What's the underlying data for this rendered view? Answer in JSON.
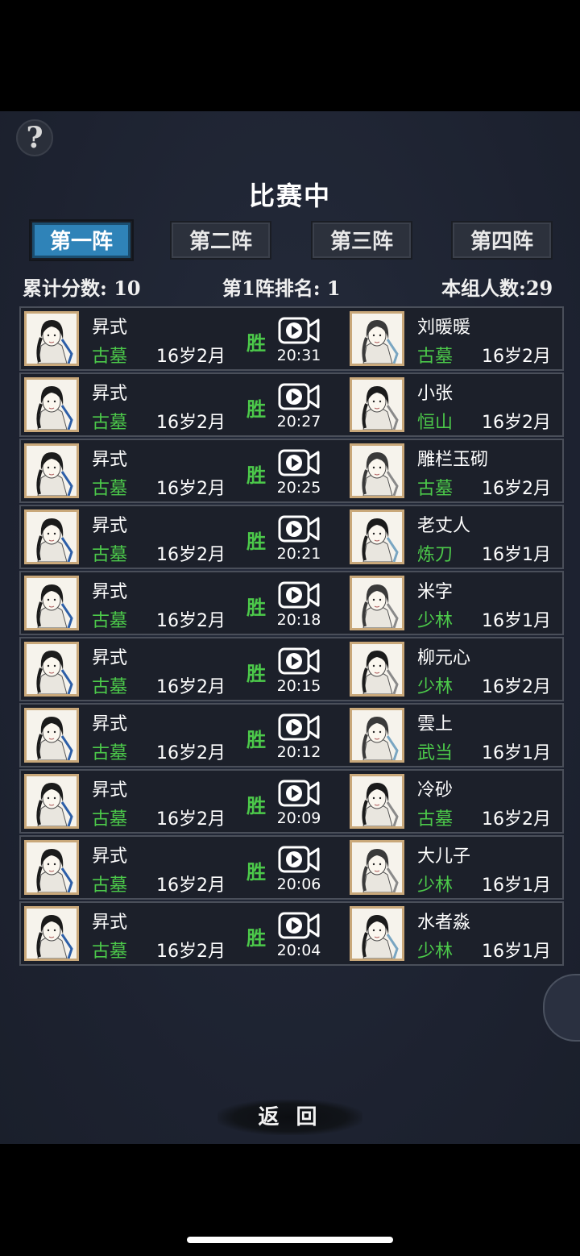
{
  "help": {
    "glyph": "?"
  },
  "title": "比赛中",
  "tabs": [
    {
      "label": "第一阵",
      "active": true
    },
    {
      "label": "第二阵",
      "active": false
    },
    {
      "label": "第三阵",
      "active": false
    },
    {
      "label": "第四阵",
      "active": false
    }
  ],
  "stats": {
    "score_label": "累计分数: 10",
    "rank_label": "第1阵排名: 1",
    "group_label": "本组人数:29"
  },
  "matches": [
    {
      "left": {
        "name": "昇式",
        "sect": "古墓",
        "age": "16岁2月"
      },
      "result": "胜",
      "time": "20:31",
      "right": {
        "name": "刘暖暖",
        "sect": "古墓",
        "age": "16岁2月"
      }
    },
    {
      "left": {
        "name": "昇式",
        "sect": "古墓",
        "age": "16岁2月"
      },
      "result": "胜",
      "time": "20:27",
      "right": {
        "name": "小张",
        "sect": "恒山",
        "age": "16岁2月"
      }
    },
    {
      "left": {
        "name": "昇式",
        "sect": "古墓",
        "age": "16岁2月"
      },
      "result": "胜",
      "time": "20:25",
      "right": {
        "name": "雕栏玉砌",
        "sect": "古墓",
        "age": "16岁2月"
      }
    },
    {
      "left": {
        "name": "昇式",
        "sect": "古墓",
        "age": "16岁2月"
      },
      "result": "胜",
      "time": "20:21",
      "right": {
        "name": "老丈人",
        "sect": "炼刀",
        "age": "16岁1月"
      }
    },
    {
      "left": {
        "name": "昇式",
        "sect": "古墓",
        "age": "16岁2月"
      },
      "result": "胜",
      "time": "20:18",
      "right": {
        "name": "米字",
        "sect": "少林",
        "age": "16岁1月"
      }
    },
    {
      "left": {
        "name": "昇式",
        "sect": "古墓",
        "age": "16岁2月"
      },
      "result": "胜",
      "time": "20:15",
      "right": {
        "name": "柳元心",
        "sect": "少林",
        "age": "16岁2月"
      }
    },
    {
      "left": {
        "name": "昇式",
        "sect": "古墓",
        "age": "16岁2月"
      },
      "result": "胜",
      "time": "20:12",
      "right": {
        "name": "雲上",
        "sect": "武当",
        "age": "16岁1月"
      }
    },
    {
      "left": {
        "name": "昇式",
        "sect": "古墓",
        "age": "16岁2月"
      },
      "result": "胜",
      "time": "20:09",
      "right": {
        "name": "冷砂",
        "sect": "古墓",
        "age": "16岁2月"
      }
    },
    {
      "left": {
        "name": "昇式",
        "sect": "古墓",
        "age": "16岁2月"
      },
      "result": "胜",
      "time": "20:06",
      "right": {
        "name": "大儿子",
        "sect": "少林",
        "age": "16岁1月"
      }
    },
    {
      "left": {
        "name": "昇式",
        "sect": "古墓",
        "age": "16岁2月"
      },
      "result": "胜",
      "time": "20:04",
      "right": {
        "name": "水者淼",
        "sect": "少林",
        "age": "16岁1月"
      }
    }
  ],
  "back_label": "返 回",
  "icons": {
    "replay": "video-camera-icon",
    "help": "question-mark-icon"
  }
}
